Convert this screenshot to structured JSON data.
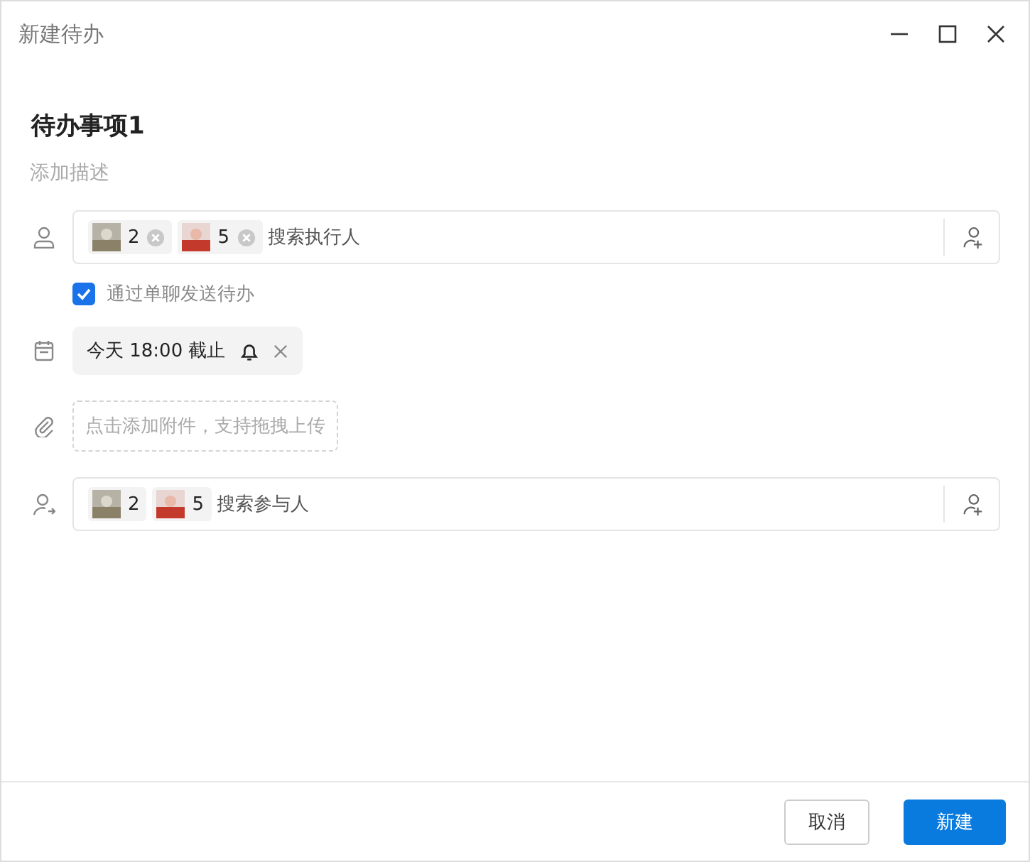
{
  "window": {
    "title": "新建待办"
  },
  "task": {
    "title": "待办事项1",
    "description_placeholder": "添加描述"
  },
  "assignees": {
    "people": [
      {
        "name": "2",
        "removable": true
      },
      {
        "name": "5",
        "removable": true
      }
    ],
    "placeholder": "搜索执行人"
  },
  "send_via_chat": {
    "label": "通过单聊发送待办",
    "checked": true
  },
  "due": {
    "text": "今天 18:00 截止"
  },
  "attachment": {
    "placeholder": "点击添加附件，支持拖拽上传"
  },
  "participants": {
    "people": [
      {
        "name": "2",
        "removable": false
      },
      {
        "name": "5",
        "removable": false
      }
    ],
    "placeholder": "搜索参与人"
  },
  "buttons": [
    {
      "label": "取消",
      "kind": "secondary"
    },
    {
      "label": "新建",
      "kind": "primary"
    }
  ]
}
